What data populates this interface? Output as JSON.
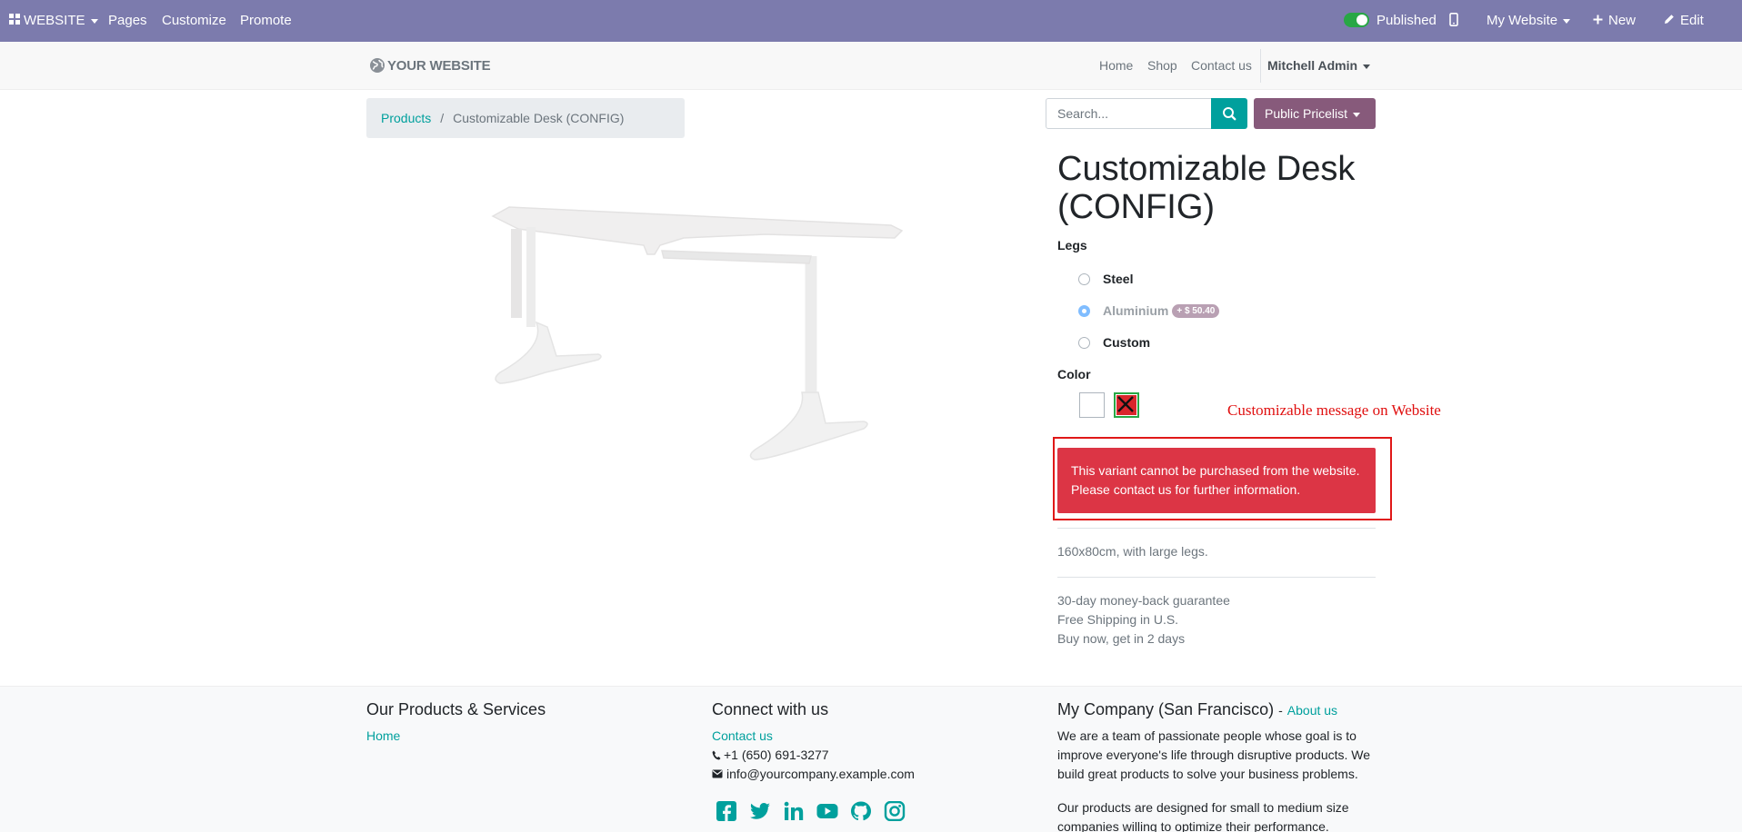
{
  "adminbar": {
    "website": "WEBSITE",
    "pages": "Pages",
    "customize": "Customize",
    "promote": "Promote",
    "published": "Published",
    "my_website": "My Website",
    "new": "New",
    "edit": "Edit"
  },
  "header": {
    "logo": "YOUR WEBSITE",
    "nav": [
      "Home",
      "Shop",
      "Contact us"
    ],
    "user": "Mitchell Admin"
  },
  "breadcrumb": {
    "parent": "Products",
    "separator": "/",
    "current": "Customizable Desk (CONFIG)"
  },
  "search": {
    "placeholder": "Search..."
  },
  "pricelist": "Public Pricelist",
  "product": {
    "title": "Customizable Desk (CONFIG)",
    "legs_label": "Legs",
    "legs_options": [
      {
        "label": "Steel",
        "checked": false
      },
      {
        "label": "Aluminium",
        "checked": true,
        "extra": "+ $ 50.40"
      },
      {
        "label": "Custom",
        "checked": false
      }
    ],
    "color_label": "Color",
    "colors": [
      "#ffffff",
      "#d9262c"
    ],
    "annotation": "Customizable message on Website",
    "warning_line1": "This variant cannot be purchased from the website.",
    "warning_line2": "Please contact us for further information.",
    "description": "160x80cm, with large legs.",
    "guarantee": [
      "30-day money-back guarantee",
      "Free Shipping in U.S.",
      "Buy now, get in 2 days"
    ]
  },
  "footer": {
    "col1_title": "Our Products & Services",
    "col1_link": "Home",
    "col2_title": "Connect with us",
    "col2_link": "Contact us",
    "phone": "+1 (650) 691-3277",
    "email": "info@yourcompany.example.com",
    "col3_title": "My Company (San Francisco)",
    "col3_sep": "-",
    "col3_link": "About us",
    "para1": "We are a team of passionate people whose goal is to improve everyone's life through disruptive products. We build great products to solve your business problems.",
    "para2": "Our products are designed for small to medium size companies willing to optimize their performance."
  },
  "colors": {
    "admin_bar": "#7c7bad",
    "primary": "#00a09d",
    "pricelist": "#875a7b",
    "danger": "#dc3545"
  }
}
